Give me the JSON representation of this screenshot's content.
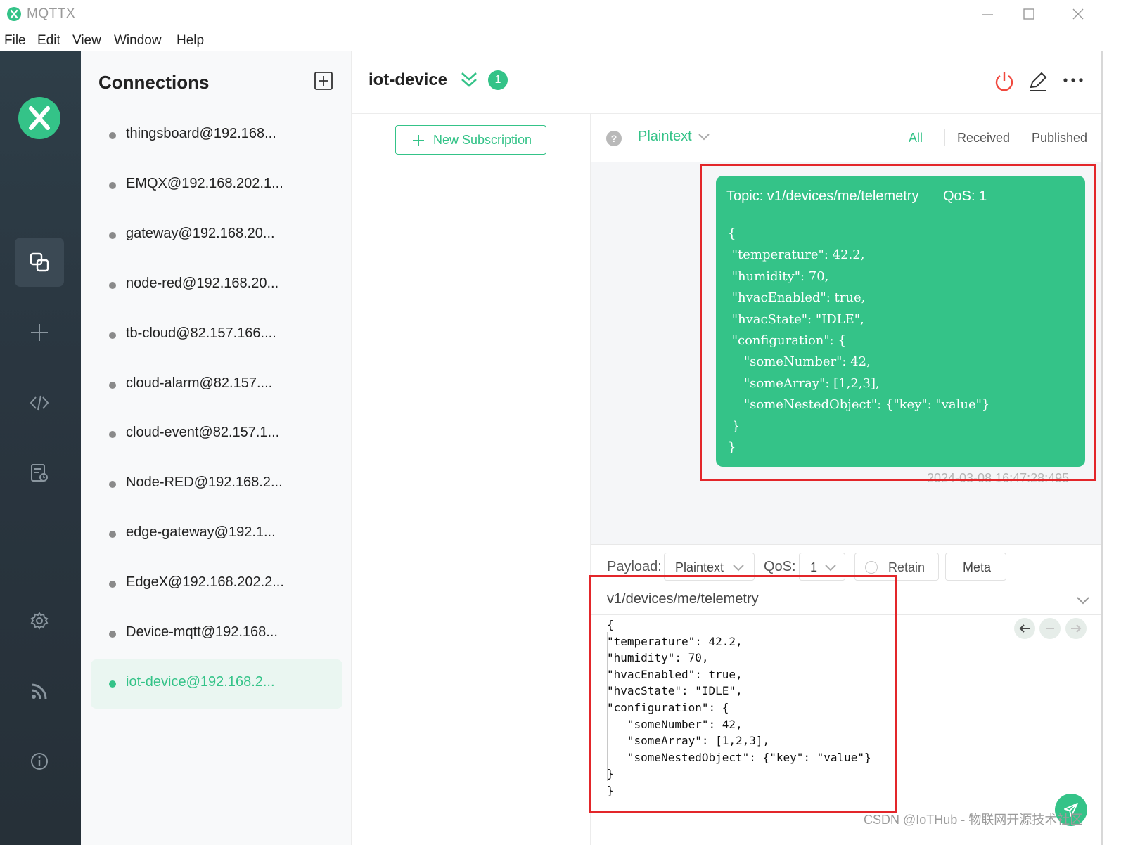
{
  "window": {
    "title": "MQTTX"
  },
  "menu": [
    "File",
    "Edit",
    "View",
    "Window",
    "Help"
  ],
  "connections_panel": {
    "title": "Connections",
    "items": [
      {
        "name": "thingsboard@192.168...",
        "active": false
      },
      {
        "name": "EMQX@192.168.202.1...",
        "active": false
      },
      {
        "name": "gateway@192.168.20...",
        "active": false
      },
      {
        "name": "node-red@192.168.20...",
        "active": false
      },
      {
        "name": "tb-cloud@82.157.166....",
        "active": false
      },
      {
        "name": "cloud-alarm@82.157....",
        "active": false
      },
      {
        "name": "cloud-event@82.157.1...",
        "active": false
      },
      {
        "name": "Node-RED@192.168.2...",
        "active": false
      },
      {
        "name": "edge-gateway@192.1...",
        "active": false
      },
      {
        "name": "EdgeX@192.168.202.2...",
        "active": false
      },
      {
        "name": "Device-mqtt@192.168...",
        "active": false
      },
      {
        "name": "iot-device@192.168.2...",
        "active": true
      }
    ]
  },
  "header": {
    "connection_name": "iot-device",
    "subscription_count": "1"
  },
  "subscriptions": {
    "new_button": "New Subscription"
  },
  "messages": {
    "format": "Plaintext",
    "help": "?",
    "filters": [
      "All",
      "Received",
      "Published"
    ],
    "active_filter": "All",
    "card": {
      "topic": "Topic: v1/devices/me/telemetry",
      "qos": "QoS: 1",
      "body": "{\n \"temperature\": 42.2,\n \"humidity\": 70,\n \"hvacEnabled\": true,\n \"hvacState\": \"IDLE\",\n \"configuration\": {\n    \"someNumber\": 42,\n    \"someArray\": [1,2,3],\n    \"someNestedObject\": {\"key\": \"value\"}\n }\n}",
      "timestamp": "2024-03-08 16:47:28:495"
    }
  },
  "publish": {
    "payload_label": "Payload:",
    "payload_format": "Plaintext",
    "qos_label": "QoS:",
    "qos_value": "1",
    "retain_label": "Retain",
    "meta_label": "Meta",
    "topic": "v1/devices/me/telemetry",
    "payload": "{\n\"temperature\": 42.2,\n\"humidity\": 70,\n\"hvacEnabled\": true,\n\"hvacState\": \"IDLE\",\n\"configuration\": {\n   \"someNumber\": 42,\n   \"someArray\": [1,2,3],\n   \"someNestedObject\": {\"key\": \"value\"}\n}\n}"
  },
  "watermark": "CSDN @IoTHub - 物联网开源技术社区",
  "colors": {
    "accent": "#34c388",
    "sidebar": "#2a3640",
    "highlight": "#e3262a"
  }
}
